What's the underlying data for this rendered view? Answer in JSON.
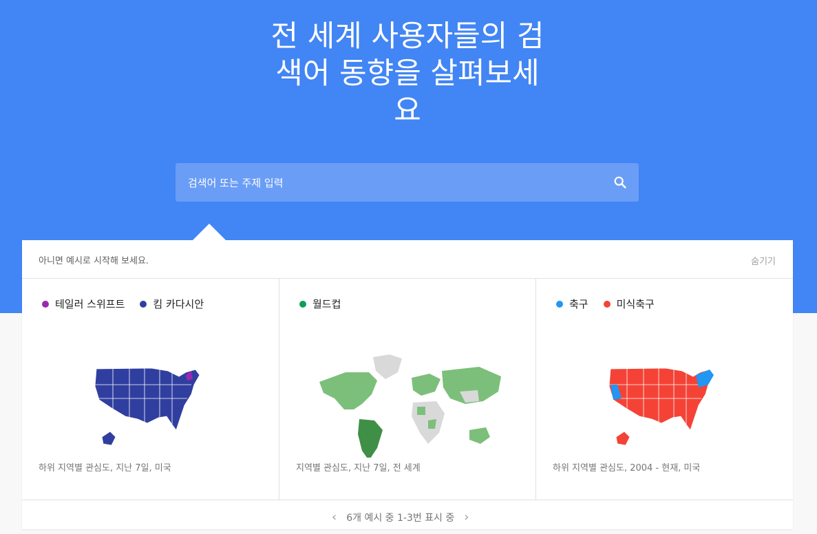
{
  "hero": {
    "title_line1": "전 세계 사용자들의 검",
    "title_line2": "색어 동향을 살펴보세",
    "title_line3": "요",
    "background": "#4285f4"
  },
  "search": {
    "placeholder": "검색어 또는 주제 입력",
    "icon": "search-icon"
  },
  "examples_panel": {
    "header_text": "아니면 예시로 시작해 보세요.",
    "hide_label": "숨기기",
    "examples": [
      {
        "legend": [
          {
            "label": "테일러 스위프트",
            "color": "#9c27b0"
          },
          {
            "label": "킴 카다시안",
            "color": "#303f9f"
          }
        ],
        "map": "us-map",
        "caption": "하위 지역별 관심도, 지난 7일, 미국"
      },
      {
        "legend": [
          {
            "label": "월드컵",
            "color": "#0f9d58"
          }
        ],
        "map": "world-map",
        "caption": "지역별 관심도, 지난 7일, 전 세계"
      },
      {
        "legend": [
          {
            "label": "축구",
            "color": "#2196f3"
          },
          {
            "label": "미식축구",
            "color": "#f44336"
          }
        ],
        "map": "us-map",
        "caption": "하위 지역별 관심도, 2004 - 현재, 미국"
      }
    ],
    "pager": {
      "prev": "‹",
      "text": "6개 예시 중 1-3번 표시 중",
      "next": "›"
    }
  }
}
